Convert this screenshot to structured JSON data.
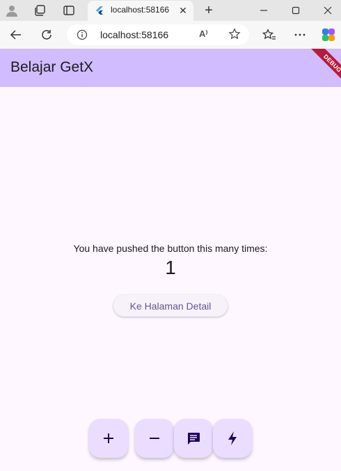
{
  "browser": {
    "tab_title": "localhost:58166",
    "address": "localhost:58166",
    "new_tab_glyph": "+",
    "close_glyph": "✕",
    "reader_glyph": "A⁾"
  },
  "app": {
    "title": "Belajar GetX",
    "debug_banner": "DEBUG",
    "counter_message": "You have pushed the button this many times:",
    "counter_value": "1",
    "detail_button_label": "Ke Halaman Detail",
    "colors": {
      "appbar": "#d0bcff",
      "background": "#fef7ff",
      "fab": "#eaddff",
      "debug": "#b71c3c"
    },
    "fabs": [
      {
        "icon": "add-icon"
      },
      {
        "icon": "remove-icon"
      },
      {
        "icon": "chat-icon"
      },
      {
        "icon": "flash-icon"
      }
    ]
  }
}
